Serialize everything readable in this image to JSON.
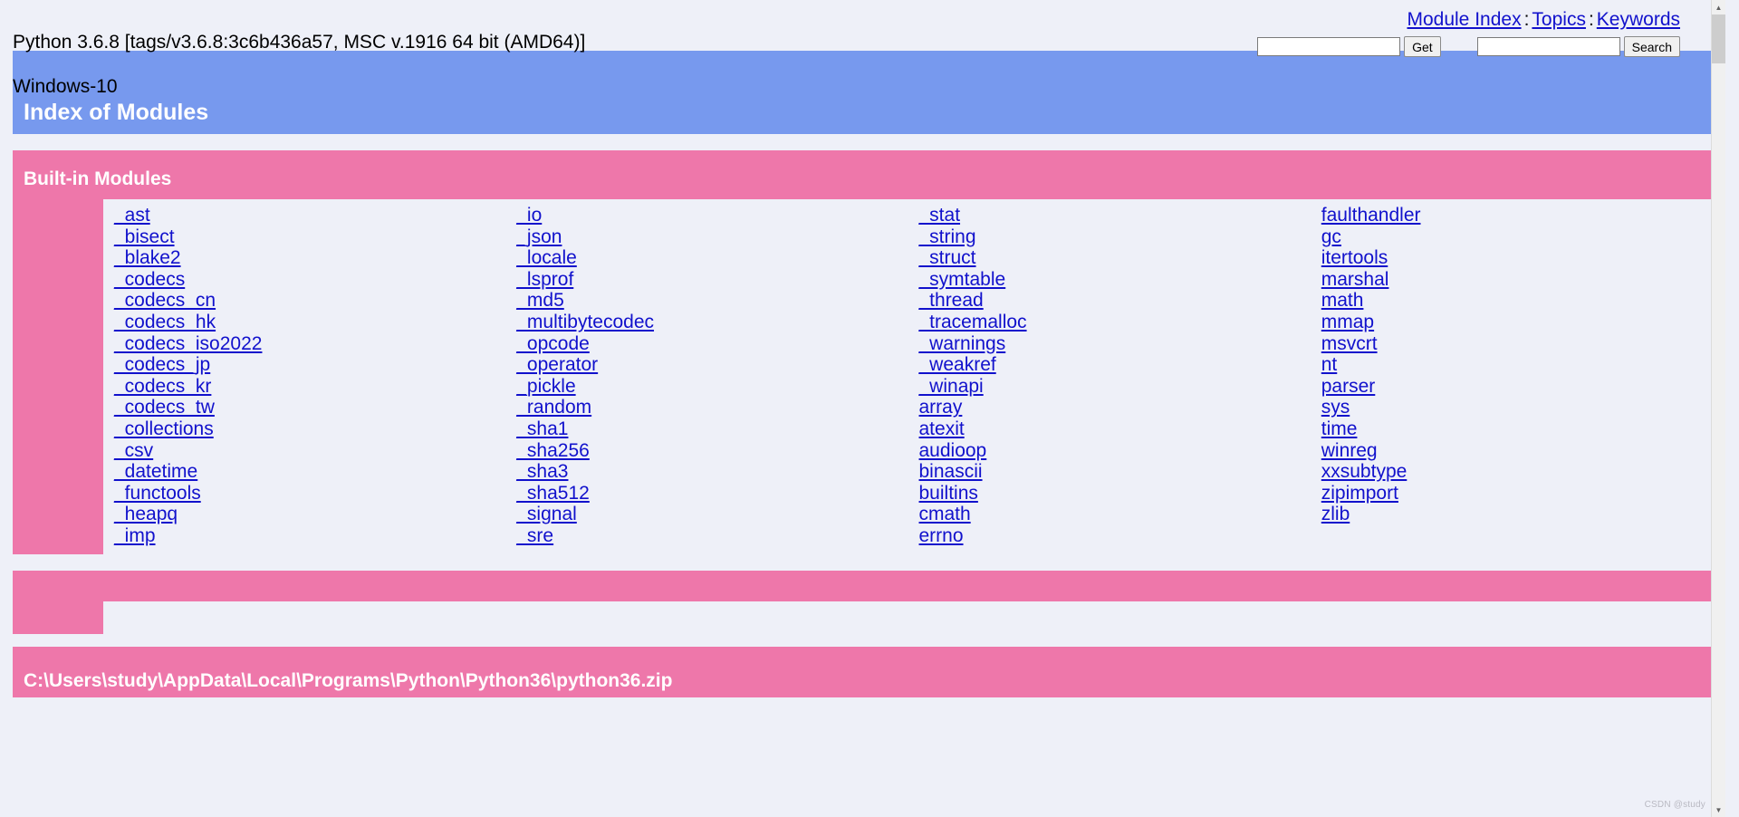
{
  "header": {
    "version_line1": "Python 3.6.8 [tags/v3.6.8:3c6b436a57, MSC v.1916 64 bit (AMD64)]",
    "version_line2": "Windows-10",
    "nav": {
      "module_index": "Module Index",
      "topics": "Topics",
      "keywords": "Keywords",
      "separator": ":"
    },
    "get_form": {
      "value": "",
      "placeholder": "",
      "button": "Get"
    },
    "search_form": {
      "value": "",
      "placeholder": "",
      "button": "Search"
    }
  },
  "page_title": "Index of Modules",
  "sections": [
    {
      "title": "Built-in Modules",
      "columns": [
        [
          "_ast",
          "_bisect",
          "_blake2",
          "_codecs",
          "_codecs_cn",
          "_codecs_hk",
          "_codecs_iso2022",
          "_codecs_jp",
          "_codecs_kr",
          "_codecs_tw",
          "_collections",
          "_csv",
          "_datetime",
          "_functools",
          "_heapq",
          "_imp"
        ],
        [
          "_io",
          "_json",
          "_locale",
          "_lsprof",
          "_md5",
          "_multibytecodec",
          "_opcode",
          "_operator",
          "_pickle",
          "_random",
          "_sha1",
          "_sha256",
          "_sha3",
          "_sha512",
          "_signal",
          "_sre"
        ],
        [
          "_stat",
          "_string",
          "_struct",
          "_symtable",
          "_thread",
          "_tracemalloc",
          "_warnings",
          "_weakref",
          "_winapi",
          "array",
          "atexit",
          "audioop",
          "binascii",
          "builtins",
          "cmath",
          "errno"
        ],
        [
          "faulthandler",
          "gc",
          "itertools",
          "marshal",
          "math",
          "mmap",
          "msvcrt",
          "nt",
          "parser",
          "sys",
          "time",
          "winreg",
          "xxsubtype",
          "zipimport",
          "zlib"
        ]
      ]
    }
  ],
  "path_section": {
    "title": "C:\\Users\\study\\AppData\\Local\\Programs\\Python\\Python36\\python36.zip"
  },
  "scrollbar": {
    "up_arrow": "▲",
    "down_arrow": "▼"
  },
  "watermark": "CSDN @study",
  "colors": {
    "banner_blue": "#7799ee",
    "banner_pink": "#ee77aa",
    "page_background": "#eef0f8",
    "link": "#1111cc"
  }
}
